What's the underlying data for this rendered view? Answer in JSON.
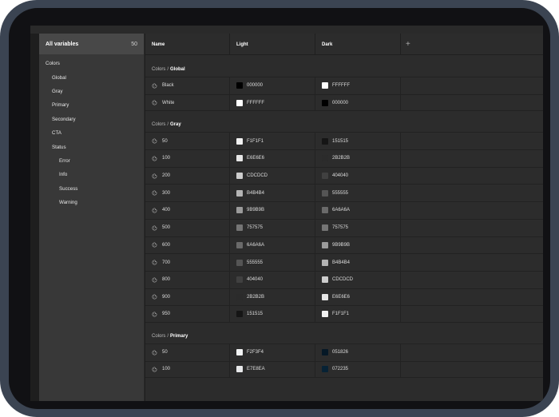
{
  "sidebar": {
    "all_label": "All variables",
    "all_count": "50",
    "items": [
      {
        "label": "Colors",
        "level": 0
      },
      {
        "label": "Global",
        "level": 1
      },
      {
        "label": "Gray",
        "level": 1
      },
      {
        "label": "Primary",
        "level": 1
      },
      {
        "label": "Secondary",
        "level": 1
      },
      {
        "label": "CTA",
        "level": 1
      },
      {
        "label": "Status",
        "level": 1
      },
      {
        "label": "Error",
        "level": 2
      },
      {
        "label": "Info",
        "level": 2
      },
      {
        "label": "Success",
        "level": 2
      },
      {
        "label": "Warning",
        "level": 2
      }
    ]
  },
  "table": {
    "columns": {
      "name": "Name",
      "light": "Light",
      "dark": "Dark",
      "add": "+"
    },
    "groups": [
      {
        "parent": "Colors",
        "separator": "/",
        "name": "Global",
        "rows": [
          {
            "name": "Black",
            "light": "000000",
            "dark": "FFFFFF"
          },
          {
            "name": "White",
            "light": "FFFFFF",
            "dark": "000000"
          }
        ]
      },
      {
        "parent": "Colors",
        "separator": "/",
        "name": "Gray",
        "rows": [
          {
            "name": "50",
            "light": "F1F1F1",
            "dark": "151515"
          },
          {
            "name": "100",
            "light": "E6E6E6",
            "dark": "2B2B2B"
          },
          {
            "name": "200",
            "light": "CDCDCD",
            "dark": "404040"
          },
          {
            "name": "300",
            "light": "B4B4B4",
            "dark": "555555"
          },
          {
            "name": "400",
            "light": "9B9B9B",
            "dark": "6A6A6A"
          },
          {
            "name": "500",
            "light": "757575",
            "dark": "757575"
          },
          {
            "name": "600",
            "light": "6A6A6A",
            "dark": "9B9B9B"
          },
          {
            "name": "700",
            "light": "555555",
            "dark": "B4B4B4"
          },
          {
            "name": "800",
            "light": "404040",
            "dark": "CDCDCD"
          },
          {
            "name": "900",
            "light": "2B2B2B",
            "dark": "E6E6E6"
          },
          {
            "name": "950",
            "light": "151515",
            "dark": "F1F1F1"
          }
        ]
      },
      {
        "parent": "Colors",
        "separator": "/",
        "name": "Primary",
        "rows": [
          {
            "name": "50",
            "light": "F2F3F4",
            "dark": "051826"
          },
          {
            "name": "100",
            "light": "E7E8EA",
            "dark": "072235"
          }
        ]
      }
    ]
  },
  "colors": {
    "device_frame": "#3b4452",
    "panel_bg": "#2c2c2c",
    "sidebar_bg": "#383838",
    "sidebar_selected_bg": "#484848"
  },
  "icons": {
    "variable": "color-variable-icon",
    "add": "plus-icon"
  }
}
